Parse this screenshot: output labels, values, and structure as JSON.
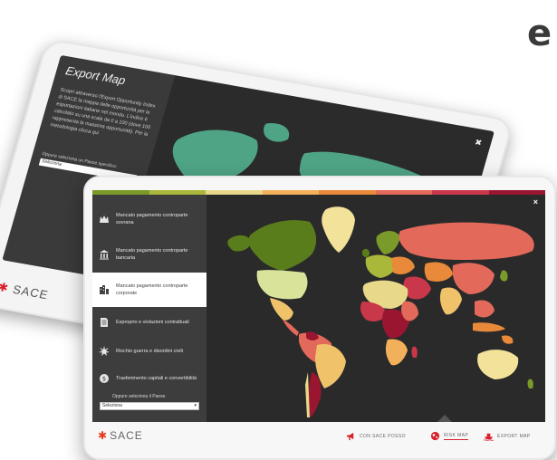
{
  "corner_text": "e",
  "back_screen": {
    "title": "Export Map",
    "description": "Scopri attraverso l'Export Opportunity Index di SACE la mappa delle opportunità per le esportazioni italiane nel mondo. L'indice è calcolato su una scala da 0 a 100 (dove 100 rappresenta la massima opportunità). Per la metodologia clicca qui",
    "select_label": "Oppure seleziona un Paese specifico:",
    "select_value": "Seleziona",
    "logo": "SACE"
  },
  "front_screen": {
    "stripe_colors": [
      "#7a9a2a",
      "#a9b83a",
      "#e8d98a",
      "#f2b05a",
      "#e98a3a",
      "#e36a5a",
      "#c8374a",
      "#9a1630"
    ],
    "menu": [
      {
        "label": "Mancato pagamento controparte sovrana",
        "icon": "sovereign-icon",
        "active": false
      },
      {
        "label": "Mancato pagamento controparte bancaria",
        "icon": "bank-icon",
        "active": false
      },
      {
        "label": "Mancato pagamento controparte corporate",
        "icon": "corporate-icon",
        "active": true
      },
      {
        "label": "Esproprio e violazioni contrattuali",
        "icon": "document-icon",
        "active": false
      },
      {
        "label": "Rischio guerra e disordini civili",
        "icon": "explosion-icon",
        "active": false
      },
      {
        "label": "Trasferimento capitali e convertibilità",
        "icon": "currency-icon",
        "active": false
      }
    ],
    "country_label": "Oppure seleziona il Paese",
    "country_select": "Seleziona",
    "close": "×",
    "logo": "SACE",
    "nav": [
      {
        "label": "CON SACE POSSO",
        "icon": "megaphone-icon",
        "active": false
      },
      {
        "label": "RISK MAP",
        "icon": "globe-icon",
        "active": true
      },
      {
        "label": "EXPORT MAP",
        "icon": "ship-icon",
        "active": false
      }
    ]
  }
}
